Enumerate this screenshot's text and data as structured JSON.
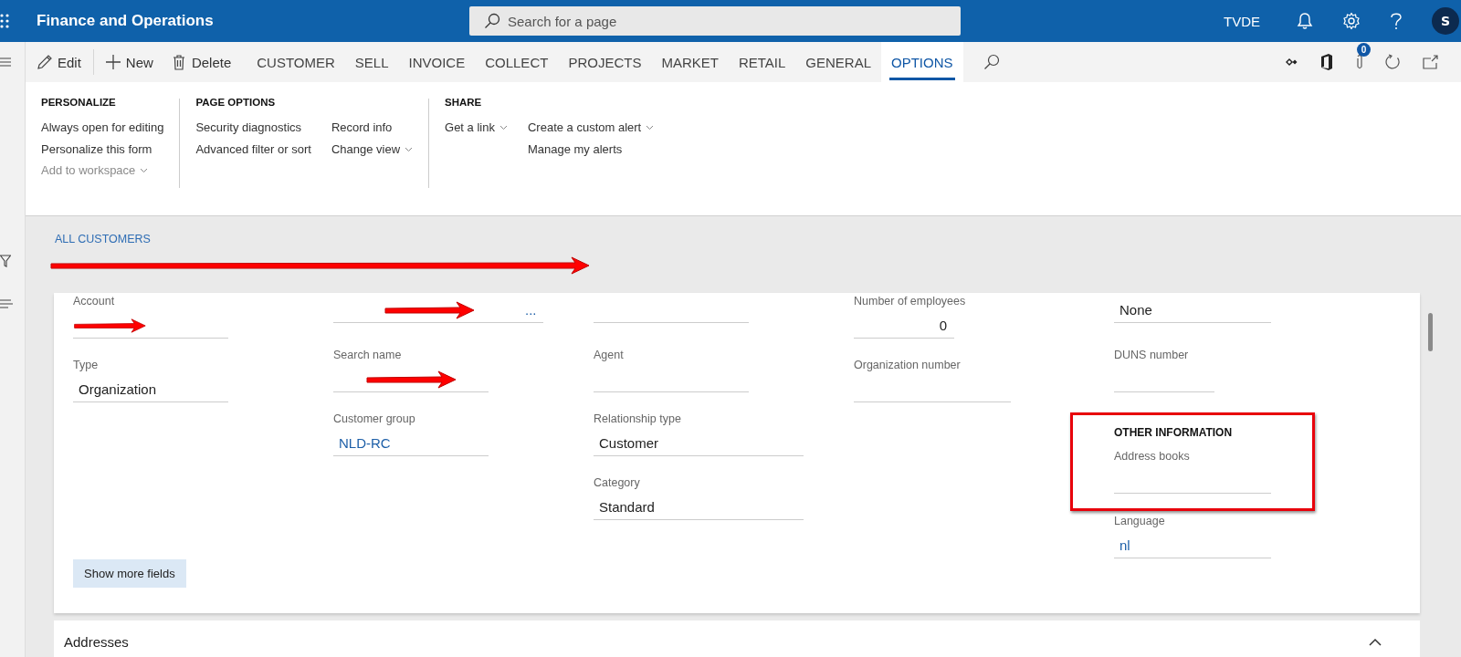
{
  "top_bar": {
    "title": "Finance and Operations",
    "search": {
      "placeholder": "Search for a page"
    },
    "company": "TVDE",
    "avatar": "S"
  },
  "action_pane": {
    "items": [
      {
        "kind": "command",
        "label": "Edit"
      },
      {
        "kind": "command",
        "label": "New"
      },
      {
        "kind": "command",
        "label": "Delete"
      },
      {
        "kind": "tab",
        "label": "CUSTOMER",
        "selected": false
      },
      {
        "kind": "tab",
        "label": "SELL",
        "selected": false
      },
      {
        "kind": "tab",
        "label": "INVOICE",
        "selected": false
      },
      {
        "kind": "tab",
        "label": "COLLECT",
        "selected": false
      },
      {
        "kind": "tab",
        "label": "PROJECTS",
        "selected": false
      },
      {
        "kind": "tab",
        "label": "MARKET",
        "selected": false
      },
      {
        "kind": "tab",
        "label": "RETAIL",
        "selected": false
      },
      {
        "kind": "tab",
        "label": "GENERAL",
        "selected": false
      },
      {
        "kind": "tab",
        "label": "OPTIONS",
        "selected": true
      }
    ],
    "attachments_badge": "0"
  },
  "ribbon": {
    "groups": [
      {
        "title": "PERSONALIZE",
        "columns": [
          [
            {
              "label": "Always open for editing",
              "dropdown": false,
              "disabled": false
            },
            {
              "label": "Personalize this form",
              "dropdown": false,
              "disabled": false
            },
            {
              "label": "Add to workspace",
              "dropdown": true,
              "disabled": true
            }
          ]
        ]
      },
      {
        "title": "PAGE OPTIONS",
        "columns": [
          [
            {
              "label": "Security diagnostics",
              "dropdown": false,
              "disabled": false
            },
            {
              "label": "Advanced filter or sort",
              "dropdown": false,
              "disabled": false
            }
          ],
          [
            {
              "label": "Record info",
              "dropdown": false,
              "disabled": false
            },
            {
              "label": "Change view",
              "dropdown": true,
              "disabled": false
            }
          ]
        ]
      },
      {
        "title": "SHARE",
        "columns": [
          [
            {
              "label": "Get a link",
              "dropdown": true,
              "disabled": false
            }
          ],
          [
            {
              "label": "Create a custom alert",
              "dropdown": true,
              "disabled": false
            },
            {
              "label": "Manage my alerts",
              "dropdown": false,
              "disabled": false
            }
          ]
        ]
      }
    ]
  },
  "header": {
    "breadcrumb": "ALL CUSTOMERS",
    "title_redacted": true
  },
  "form": {
    "columns": [
      [
        {
          "label": "Account",
          "kind": "text",
          "redacted": true
        },
        {
          "label": "Type",
          "value": "Organization",
          "kind": "text",
          "redacted": false
        }
      ],
      [
        {
          "value": "...",
          "kind": "link",
          "redacted": true
        },
        {
          "label": "Search name",
          "kind": "text",
          "redacted": true
        },
        {
          "label": "Customer group",
          "value": "NLD-RC",
          "kind": "link",
          "redacted": false
        }
      ],
      [
        {
          "kind": "text",
          "redacted": false
        },
        {
          "label": "Agent",
          "kind": "text",
          "redacted": false
        },
        {
          "label": "Relationship type",
          "value": "Customer",
          "kind": "text",
          "redacted": false
        },
        {
          "label": "Category",
          "value": "Standard",
          "kind": "text",
          "redacted": false
        }
      ],
      [
        {
          "label": "Number of employees",
          "value": "0",
          "kind": "number",
          "redacted": false
        },
        {
          "label": "Organization number",
          "kind": "text",
          "redacted": false
        }
      ],
      [
        {
          "value": "None",
          "kind": "text",
          "redacted": false
        },
        {
          "label": "DUNS number",
          "kind": "short",
          "redacted": false
        },
        {
          "kind": "section",
          "title": "OTHER INFORMATION",
          "highlighted": true,
          "fields": [
            {
              "label": "Address books",
              "redacted": false
            }
          ]
        },
        {
          "label": "Language",
          "value": "nl",
          "kind": "link",
          "redacted": false
        }
      ]
    ],
    "show_more": "Show more fields"
  },
  "addresses": {
    "title": "Addresses",
    "expanded": true
  }
}
